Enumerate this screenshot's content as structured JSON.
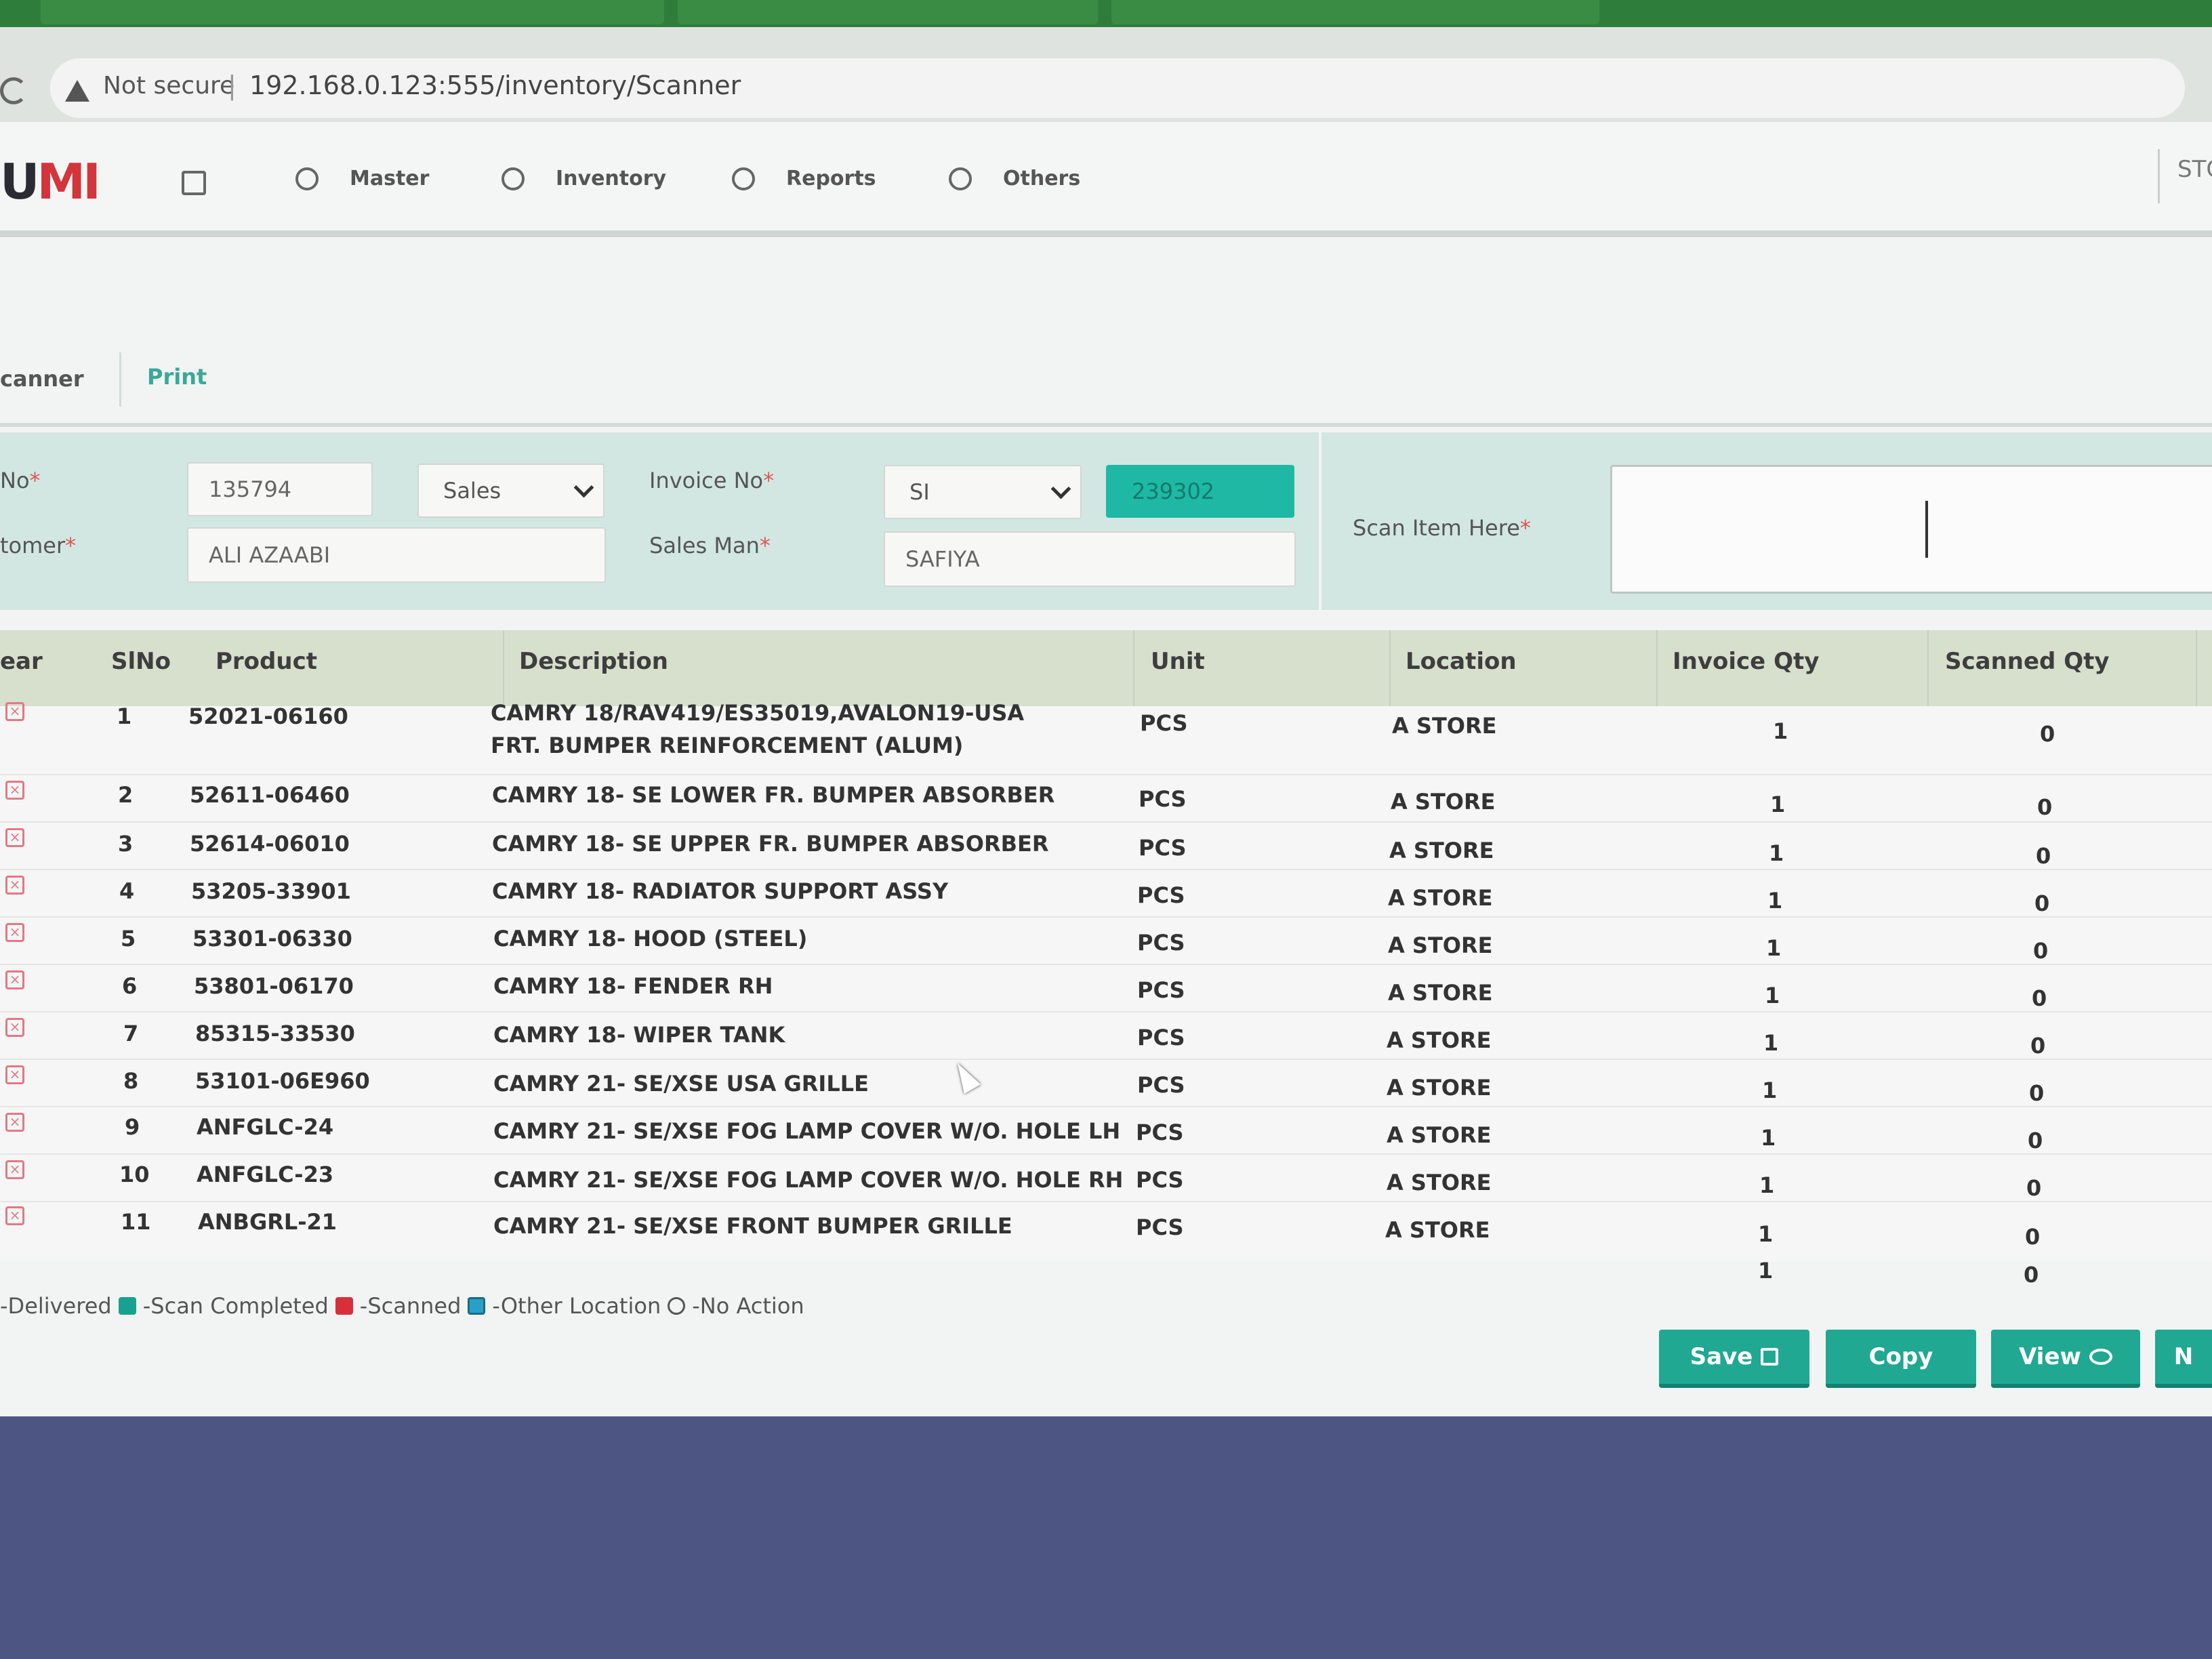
{
  "browser": {
    "not_secure": "Not secure",
    "url": "192.168.0.123:555/inventory/Scanner"
  },
  "app": {
    "logo_a": "U",
    "logo_b": "MI",
    "nav": [
      "Master",
      "Inventory",
      "Reports",
      "Others"
    ],
    "store": "STOR"
  },
  "subtabs": {
    "scanner": "canner",
    "print": "Print"
  },
  "form": {
    "no_label": "No",
    "no_value": "135794",
    "type_value": "Sales",
    "invoice_label": "Invoice No",
    "invoice_prefix": "SI",
    "invoice_number": "239302",
    "customer_label": "tomer",
    "customer_value": "ALI AZAABI",
    "salesman_label": "Sales Man",
    "salesman_value": "SAFIYA",
    "scan_label": "Scan Item Here",
    "required_mark": "*"
  },
  "table": {
    "headers": [
      "ear",
      "SlNo",
      "Product",
      "Description",
      "Unit",
      "Location",
      "Invoice Qty",
      "Scanned Qty"
    ],
    "rows": [
      {
        "sl": "1",
        "product": "52021-06160",
        "desc": "CAMRY 18/RAV419/ES35019,AVALON19-USA FRT. BUMPER REINFORCEMENT (ALUM)",
        "unit": "PCS",
        "location": "A STORE",
        "inv": "1",
        "scan": "0"
      },
      {
        "sl": "2",
        "product": "52611-06460",
        "desc": "CAMRY 18- SE LOWER FR. BUMPER ABSORBER",
        "unit": "PCS",
        "location": "A STORE",
        "inv": "1",
        "scan": "0"
      },
      {
        "sl": "3",
        "product": "52614-06010",
        "desc": "CAMRY 18- SE UPPER FR. BUMPER ABSORBER",
        "unit": "PCS",
        "location": "A STORE",
        "inv": "1",
        "scan": "0"
      },
      {
        "sl": "4",
        "product": "53205-33901",
        "desc": "CAMRY 18- RADIATOR SUPPORT ASSY",
        "unit": "PCS",
        "location": "A STORE",
        "inv": "1",
        "scan": "0"
      },
      {
        "sl": "5",
        "product": "53301-06330",
        "desc": "CAMRY 18- HOOD (STEEL)",
        "unit": "PCS",
        "location": "A STORE",
        "inv": "1",
        "scan": "0"
      },
      {
        "sl": "6",
        "product": "53801-06170",
        "desc": "CAMRY 18- FENDER RH",
        "unit": "PCS",
        "location": "A STORE",
        "inv": "1",
        "scan": "0"
      },
      {
        "sl": "7",
        "product": "85315-33530",
        "desc": "CAMRY 18- WIPER TANK",
        "unit": "PCS",
        "location": "A STORE",
        "inv": "1",
        "scan": "0"
      },
      {
        "sl": "8",
        "product": "53101-06E960",
        "desc": "CAMRY 21- SE/XSE USA GRILLE",
        "unit": "PCS",
        "location": "A STORE",
        "inv": "1",
        "scan": "0"
      },
      {
        "sl": "9",
        "product": "ANFGLC-24",
        "desc": "CAMRY 21- SE/XSE FOG LAMP COVER W/O. HOLE LH",
        "unit": "PCS",
        "location": "A STORE",
        "inv": "1",
        "scan": "0"
      },
      {
        "sl": "10",
        "product": "ANFGLC-23",
        "desc": "CAMRY 21- SE/XSE FOG LAMP COVER W/O. HOLE RH",
        "unit": "PCS",
        "location": "A STORE",
        "inv": "1",
        "scan": "0"
      },
      {
        "sl": "11",
        "product": "ANBGRL-21",
        "desc": "CAMRY 21- SE/XSE FRONT BUMPER GRILLE",
        "unit": "PCS",
        "location": "A STORE",
        "inv": "1",
        "scan": "0"
      }
    ]
  },
  "legend": {
    "delivered": "-Delivered",
    "scan_completed": "-Scan Completed",
    "scanned": "-Scanned",
    "other_location": "-Other Location",
    "no_action": "-No Action"
  },
  "buttons": {
    "save": "Save",
    "copy": "Copy",
    "view": "View",
    "next": "N"
  },
  "colors": {
    "accent": "#20a892",
    "invoice_highlight": "#1fb8a4",
    "form_bg": "#d2e7e2",
    "table_head": "#d7dfcd"
  }
}
